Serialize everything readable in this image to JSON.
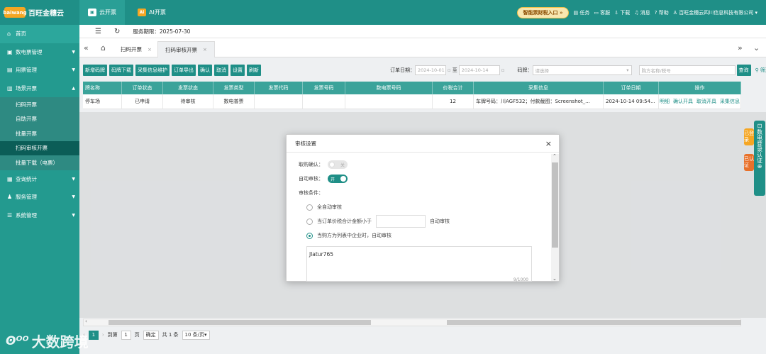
{
  "app": {
    "logo_mark": "baiwang",
    "logo_text": "百旺金穗云",
    "tabs": [
      {
        "label": "云开票",
        "icon": "invoice-icon"
      },
      {
        "label": "AI开票",
        "icon": "ai-icon",
        "badge": "Ai"
      }
    ],
    "promo": "智能票财税入口 »",
    "links": [
      "任务",
      "客服",
      "下载",
      "消息",
      "帮助"
    ],
    "company": "百旺金穗云四川信息科技有限公司"
  },
  "sidebar": {
    "items": [
      {
        "label": "首页",
        "icon": "home-icon"
      },
      {
        "label": "数电票管理",
        "icon": "invoice-mgmt-icon",
        "arrow": "▼"
      },
      {
        "label": "用票管理",
        "icon": "ticket-icon",
        "arrow": "▼"
      },
      {
        "label": "场景开票",
        "icon": "scene-icon",
        "arrow": "▲"
      }
    ],
    "subitems": [
      "扫码开票",
      "自助开票",
      "批量开票",
      "扫码审核开票",
      "批量下载（电票）"
    ],
    "items2": [
      {
        "label": "查询统计",
        "icon": "search-stat-icon",
        "arrow": "▼"
      },
      {
        "label": "服务管理",
        "icon": "service-icon",
        "arrow": "▼"
      },
      {
        "label": "系统管理",
        "icon": "system-icon",
        "arrow": "▼"
      }
    ],
    "watermark": "大数跨境"
  },
  "crumb": {
    "service_period": "服务期限：2025-07-30"
  },
  "tabs": {
    "items": [
      "扫码开票",
      "扫码审核开票"
    ]
  },
  "toolbar": {
    "buttons": [
      "新增码牌",
      "码牌下载",
      "采集信息维护",
      "订单导出",
      "确认",
      "取消",
      "设置",
      "刷新"
    ]
  },
  "filters": {
    "order_date_label": "订单日期：",
    "date_start": "2024-10-01",
    "date_sep": "至",
    "date_end": "2024-10-14",
    "code_label": "码牌：",
    "code_placeholder": "请选择",
    "buyer_placeholder": "购方名称/税号",
    "search_label": "查询",
    "filter_label": "筛选"
  },
  "table": {
    "headers": [
      "牌名称",
      "订单状态",
      "发票状态",
      "发票类型",
      "发票代码",
      "发票号码",
      "数电票号码",
      "价税合计",
      "采集信息",
      "订单日期",
      "操作"
    ],
    "rows": [
      {
        "name": "停车场",
        "order_status": "已申请",
        "invoice_status": "待审核",
        "invoice_type": "数电普票",
        "code": "",
        "number": "",
        "digital_number": "",
        "amount": "12",
        "collect": "车牌号码：川AGF532；付款截图：Screenshot_...",
        "date": "2024-10-14 09:54...",
        "actions": [
          "明细",
          "确认开具",
          "取消开具",
          "采集信息"
        ]
      }
    ]
  },
  "pager": {
    "current": "1",
    "prev": "‹",
    "next": "›",
    "goto": "到第",
    "page_input": "1",
    "page_unit": "页",
    "confirm": "确定",
    "total": "共 1 条",
    "page_size": "10 条/页"
  },
  "floats": {
    "register": "已登录",
    "certified": "已认证",
    "digital_login": "数电登录认证"
  },
  "modal": {
    "title": "审核设置",
    "buy_confirm_label": "取购确认：",
    "buy_confirm_state": "关",
    "auto_audit_label": "自动审核：",
    "auto_audit_state": "开",
    "condition_label": "审核条件：",
    "options": [
      {
        "label": "全自动审核",
        "selected": false
      },
      {
        "label": "当订单价税合计金额小于",
        "selected": false,
        "suffix": "自动审核"
      },
      {
        "label": "当购方为列表中企业时，自动审核",
        "selected": true
      }
    ],
    "textarea_value": "Jlatur765",
    "textarea_count": "9/1000"
  }
}
